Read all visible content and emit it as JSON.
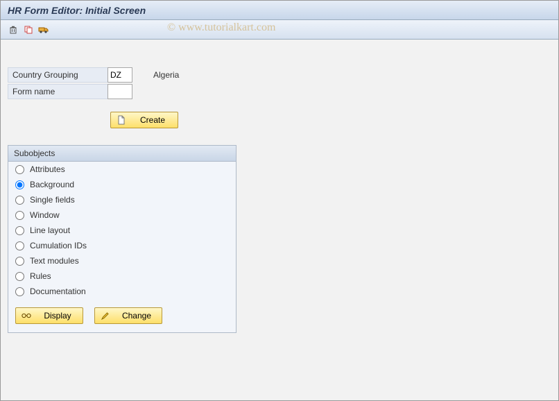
{
  "title": "HR Form Editor: Initial Screen",
  "watermark": "© www.tutorialkart.com",
  "toolbar": {
    "delete_tip": "Delete",
    "copy_tip": "Copy",
    "transport_tip": "Transport"
  },
  "form": {
    "country_label": "Country Grouping",
    "country_value": "DZ",
    "country_desc": "Algeria",
    "name_label": "Form name",
    "name_value": ""
  },
  "buttons": {
    "create": "Create",
    "display": "Display",
    "change": "Change"
  },
  "subobjects": {
    "title": "Subobjects",
    "items": [
      {
        "label": "Attributes",
        "selected": false
      },
      {
        "label": "Background",
        "selected": true
      },
      {
        "label": "Single fields",
        "selected": false
      },
      {
        "label": "Window",
        "selected": false
      },
      {
        "label": "Line layout",
        "selected": false
      },
      {
        "label": "Cumulation IDs",
        "selected": false
      },
      {
        "label": "Text modules",
        "selected": false
      },
      {
        "label": "Rules",
        "selected": false
      },
      {
        "label": "Documentation",
        "selected": false
      }
    ]
  }
}
